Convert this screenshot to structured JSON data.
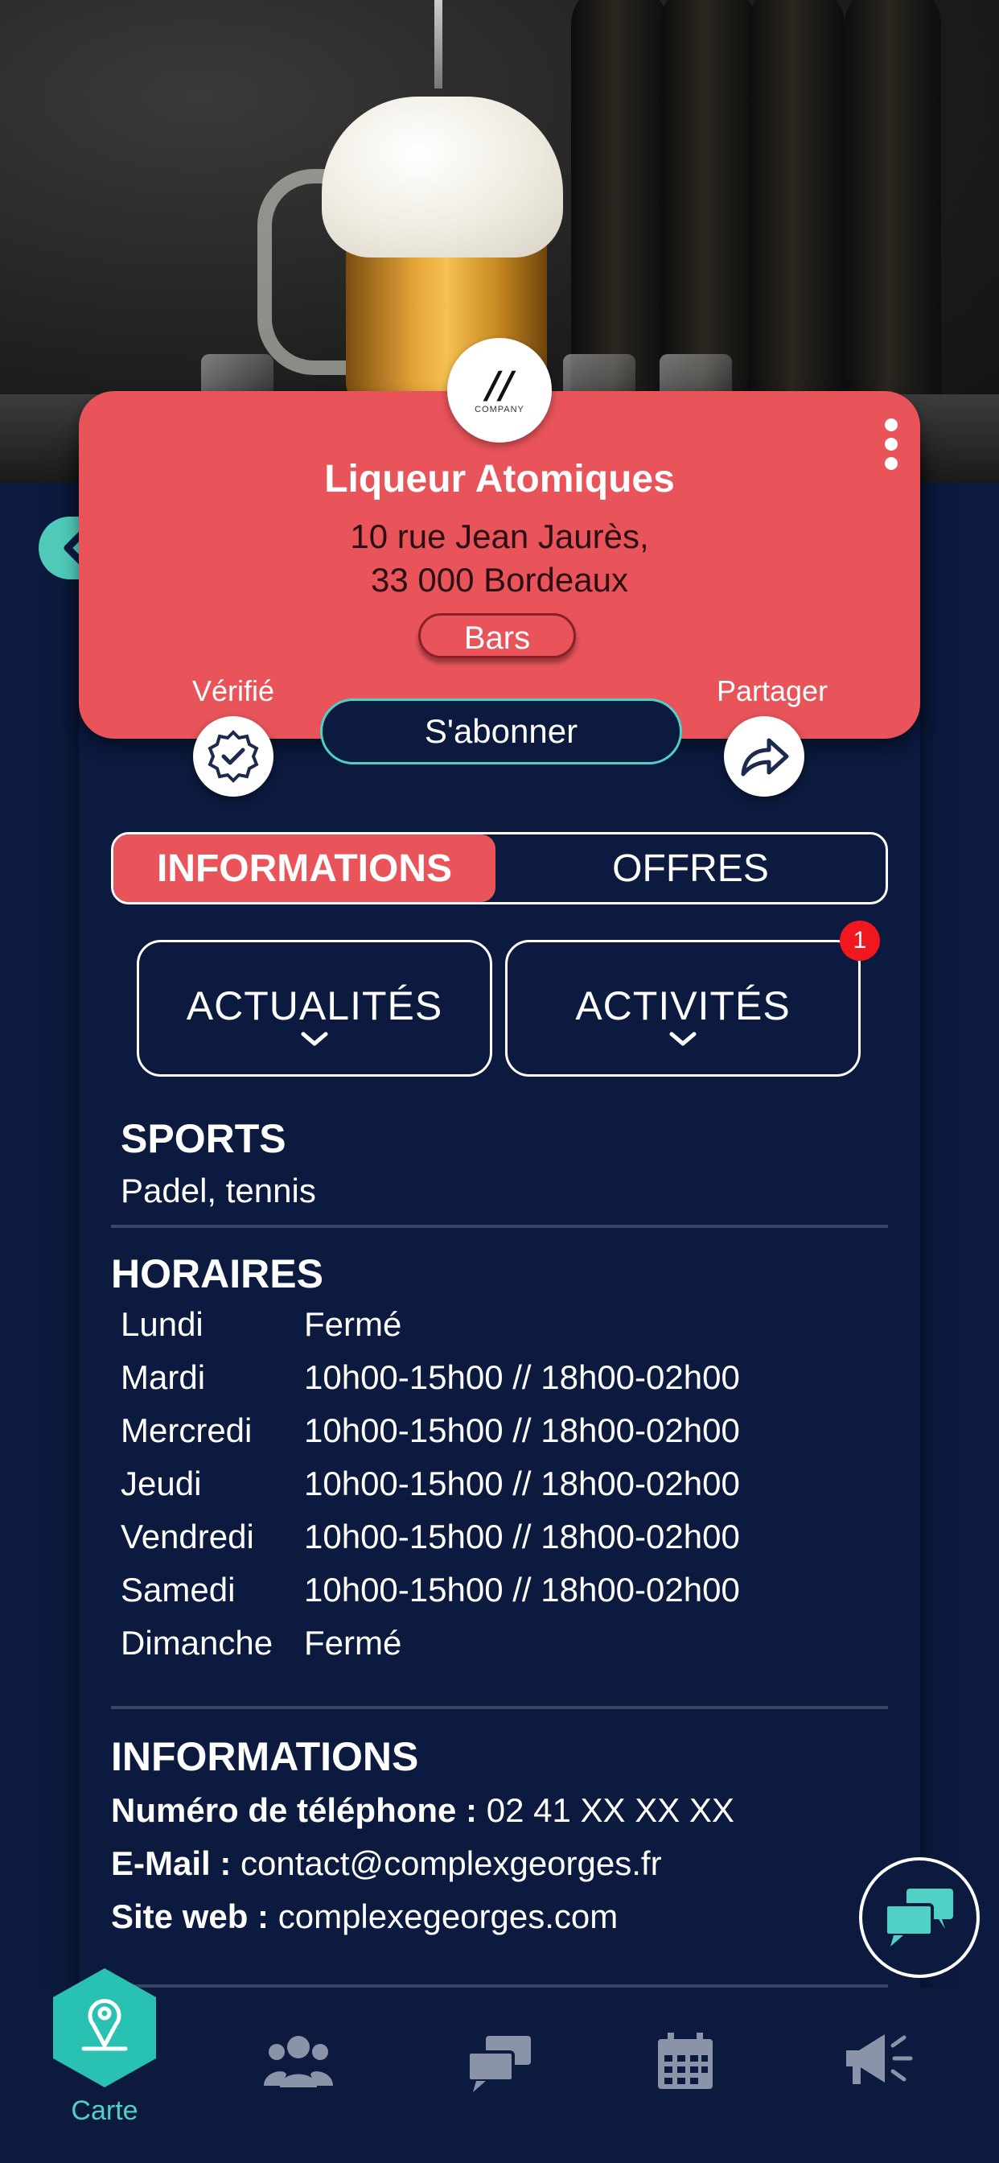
{
  "venue": {
    "name": "Liqueur Atomiques",
    "address_line1": "10 rue Jean Jaurès,",
    "address_line2": "33 000 Bordeaux",
    "category": "Bars",
    "logo_text": "COMPANY"
  },
  "actions": {
    "verified_label": "Vérifié",
    "share_label": "Partager",
    "subscribe_label": "S'abonner"
  },
  "tabs": [
    {
      "label": "INFORMATIONS",
      "active": true
    },
    {
      "label": "OFFRES",
      "active": false
    }
  ],
  "sections_buttons": [
    {
      "label": "ACTUALITÉS"
    },
    {
      "label": "ACTIVITÉS",
      "badge": "1"
    }
  ],
  "sports": {
    "title": "SPORTS",
    "value": "Padel, tennis"
  },
  "hours": {
    "title": "HORAIRES",
    "rows": [
      {
        "day": "Lundi",
        "time": "Fermé"
      },
      {
        "day": "Mardi",
        "time": "10h00-15h00 // 18h00-02h00"
      },
      {
        "day": "Mercredi",
        "time": "10h00-15h00 // 18h00-02h00"
      },
      {
        "day": "Jeudi",
        "time": "10h00-15h00 // 18h00-02h00"
      },
      {
        "day": "Vendredi",
        "time": "10h00-15h00 // 18h00-02h00"
      },
      {
        "day": "Samedi",
        "time": "10h00-15h00 // 18h00-02h00"
      },
      {
        "day": "Dimanche",
        "time": "Fermé"
      }
    ]
  },
  "information": {
    "title": "INFORMATIONS",
    "phone_label": "Numéro de téléphone :",
    "phone_value": "02 41 XX XX XX",
    "email_label": "E-Mail :",
    "email_value": "contact@complexgeorges.fr",
    "website_label": "Site web :",
    "website_value": "complexegeorges.com"
  },
  "nav": {
    "active_label": "Carte",
    "items": [
      "map-pin-icon",
      "users-icon",
      "chat-icon",
      "calendar-icon",
      "megaphone-icon"
    ]
  },
  "colors": {
    "background": "#0b1a3e",
    "card": "#e8545a",
    "accent": "#4fd1c5",
    "badge": "#f0171f"
  }
}
